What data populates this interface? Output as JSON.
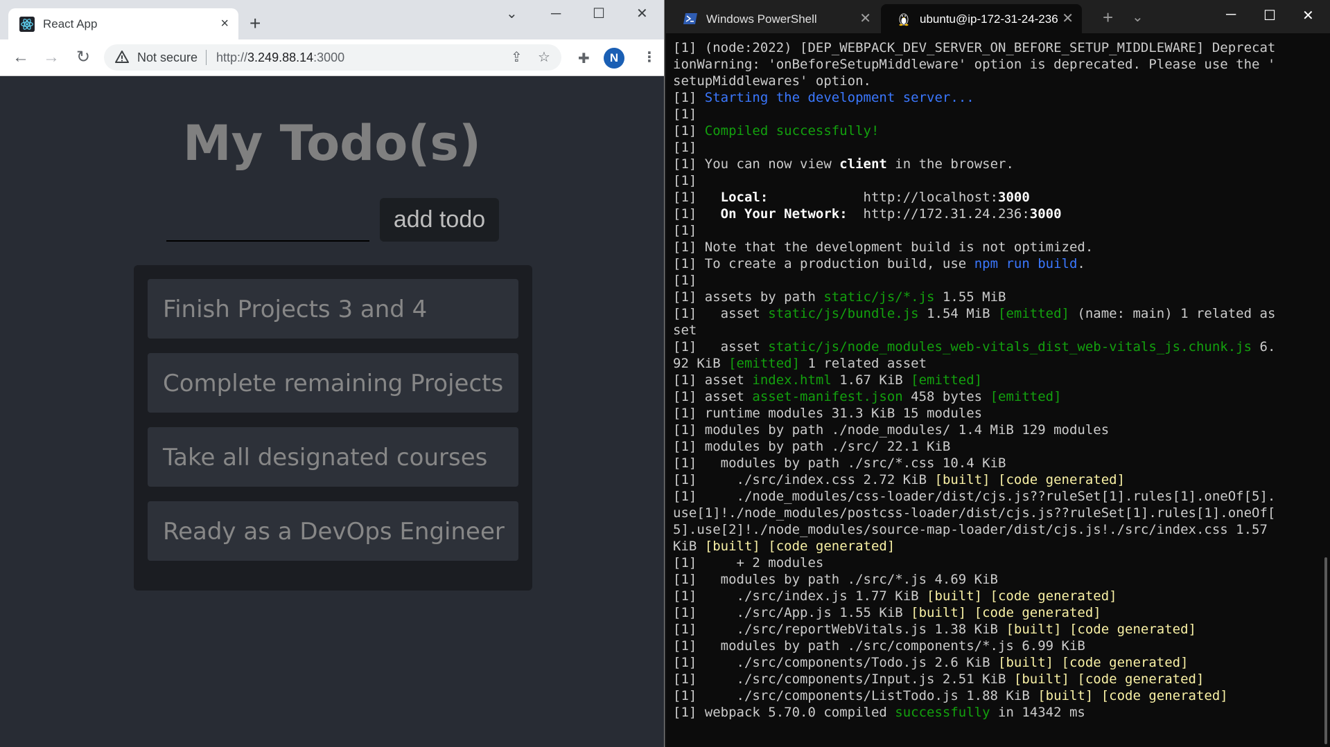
{
  "browser": {
    "tab_title": "React App",
    "tab_close": "×",
    "new_tab": "+",
    "security_label": "Not secure",
    "url_prefix": "http://",
    "url_host": "3.249.88.14",
    "url_port": ":3000",
    "profile_initial": "N",
    "controls": {
      "minimize": "─",
      "maximize": "☐",
      "close": "✕",
      "dropdown": "⌄"
    }
  },
  "app": {
    "title": "My Todo(s)",
    "input_value": "",
    "add_button": "add todo",
    "todos": [
      "Finish Projects 3 and 4",
      "Complete remaining Projects",
      "Take all designated courses",
      "Ready as a DevOps Engineer"
    ]
  },
  "terminal": {
    "tabs": [
      {
        "title": "Windows PowerShell",
        "icon": "powershell-icon"
      },
      {
        "title": "ubuntu@ip-172-31-24-236: ·",
        "icon": "linux-penguin-icon"
      }
    ],
    "lines": [
      [
        [
          "[1] (node:2022) [DEP_WEBPACK_DEV_SERVER_ON_BEFORE_SETUP_MIDDLEWARE] Deprecat",
          ""
        ]
      ],
      [
        [
          "ionWarning: 'onBeforeSetupMiddleware' option is deprecated. Please use the '",
          ""
        ]
      ],
      [
        [
          "setupMiddlewares' option.",
          ""
        ]
      ],
      [
        [
          "[1] ",
          ""
        ],
        [
          "Starting the development server...",
          "b"
        ]
      ],
      [
        [
          "[1]",
          ""
        ]
      ],
      [
        [
          "[1] ",
          ""
        ],
        [
          "Compiled successfully!",
          "g"
        ]
      ],
      [
        [
          "[1]",
          ""
        ]
      ],
      [
        [
          "[1] You can now view ",
          ""
        ],
        [
          "client",
          "w"
        ],
        [
          " in the browser.",
          ""
        ]
      ],
      [
        [
          "[1]",
          ""
        ]
      ],
      [
        [
          "[1]   ",
          ""
        ],
        [
          "Local:",
          "w"
        ],
        [
          "            http://localhost:",
          ""
        ],
        [
          "3000",
          "w"
        ]
      ],
      [
        [
          "[1]   ",
          ""
        ],
        [
          "On Your Network:",
          "w"
        ],
        [
          "  http://172.31.24.236:",
          ""
        ],
        [
          "3000",
          "w"
        ]
      ],
      [
        [
          "[1]",
          ""
        ]
      ],
      [
        [
          "[1] Note that the development build is not optimized.",
          ""
        ]
      ],
      [
        [
          "[1] To create a production build, use ",
          ""
        ],
        [
          "npm run build",
          "b"
        ],
        [
          ".",
          ""
        ]
      ],
      [
        [
          "[1]",
          ""
        ]
      ],
      [
        [
          "[1] assets by path ",
          ""
        ],
        [
          "static/js/*.js",
          "g"
        ],
        [
          " 1.55 MiB",
          ""
        ]
      ],
      [
        [
          "[1]   asset ",
          ""
        ],
        [
          "static/js/bundle.js",
          "g"
        ],
        [
          " 1.54 MiB ",
          ""
        ],
        [
          "[emitted]",
          "g"
        ],
        [
          " (name: main) 1 related as",
          ""
        ]
      ],
      [
        [
          "set",
          ""
        ]
      ],
      [
        [
          "[1]   asset ",
          ""
        ],
        [
          "static/js/node_modules_web-vitals_dist_web-vitals_js.chunk.js",
          "g"
        ],
        [
          " 6.",
          ""
        ]
      ],
      [
        [
          "92 KiB ",
          ""
        ],
        [
          "[emitted]",
          "g"
        ],
        [
          " 1 related asset",
          ""
        ]
      ],
      [
        [
          "[1] asset ",
          ""
        ],
        [
          "index.html",
          "g"
        ],
        [
          " 1.67 KiB ",
          ""
        ],
        [
          "[emitted]",
          "g"
        ]
      ],
      [
        [
          "[1] asset ",
          ""
        ],
        [
          "asset-manifest.json",
          "g"
        ],
        [
          " 458 bytes ",
          ""
        ],
        [
          "[emitted]",
          "g"
        ]
      ],
      [
        [
          "[1] runtime modules 31.3 KiB 15 modules",
          ""
        ]
      ],
      [
        [
          "[1] modules by path ./node_modules/ 1.4 MiB 129 modules",
          ""
        ]
      ],
      [
        [
          "[1] modules by path ./src/ 22.1 KiB",
          ""
        ]
      ],
      [
        [
          "[1]   modules by path ./src/*.css 10.4 KiB",
          ""
        ]
      ],
      [
        [
          "[1]     ./src/index.css 2.72 KiB ",
          ""
        ],
        [
          "[built] [code generated]",
          "y"
        ]
      ],
      [
        [
          "[1]     ./node_modules/css-loader/dist/cjs.js??ruleSet[1].rules[1].oneOf[5].",
          ""
        ]
      ],
      [
        [
          "use[1]!./node_modules/postcss-loader/dist/cjs.js??ruleSet[1].rules[1].oneOf[",
          ""
        ]
      ],
      [
        [
          "5].use[2]!./node_modules/source-map-loader/dist/cjs.js!./src/index.css 1.57",
          ""
        ]
      ],
      [
        [
          "KiB ",
          ""
        ],
        [
          "[built] [code generated]",
          "y"
        ]
      ],
      [
        [
          "[1]     + 2 modules",
          ""
        ]
      ],
      [
        [
          "[1]   modules by path ./src/*.js 4.69 KiB",
          ""
        ]
      ],
      [
        [
          "[1]     ./src/index.js 1.77 KiB ",
          ""
        ],
        [
          "[built] [code generated]",
          "y"
        ]
      ],
      [
        [
          "[1]     ./src/App.js 1.55 KiB ",
          ""
        ],
        [
          "[built] [code generated]",
          "y"
        ]
      ],
      [
        [
          "[1]     ./src/reportWebVitals.js 1.38 KiB ",
          ""
        ],
        [
          "[built] [code generated]",
          "y"
        ]
      ],
      [
        [
          "[1]   modules by path ./src/components/*.js 6.99 KiB",
          ""
        ]
      ],
      [
        [
          "[1]     ./src/components/Todo.js 2.6 KiB ",
          ""
        ],
        [
          "[built] [code generated]",
          "y"
        ]
      ],
      [
        [
          "[1]     ./src/components/Input.js 2.51 KiB ",
          ""
        ],
        [
          "[built] [code generated]",
          "y"
        ]
      ],
      [
        [
          "[1]     ./src/components/ListTodo.js 1.88 KiB ",
          ""
        ],
        [
          "[built] [code generated]",
          "y"
        ]
      ],
      [
        [
          "[1] webpack 5.70.0 compiled ",
          ""
        ],
        [
          "successfully",
          "g"
        ],
        [
          " in 14342 ms",
          ""
        ]
      ]
    ]
  }
}
